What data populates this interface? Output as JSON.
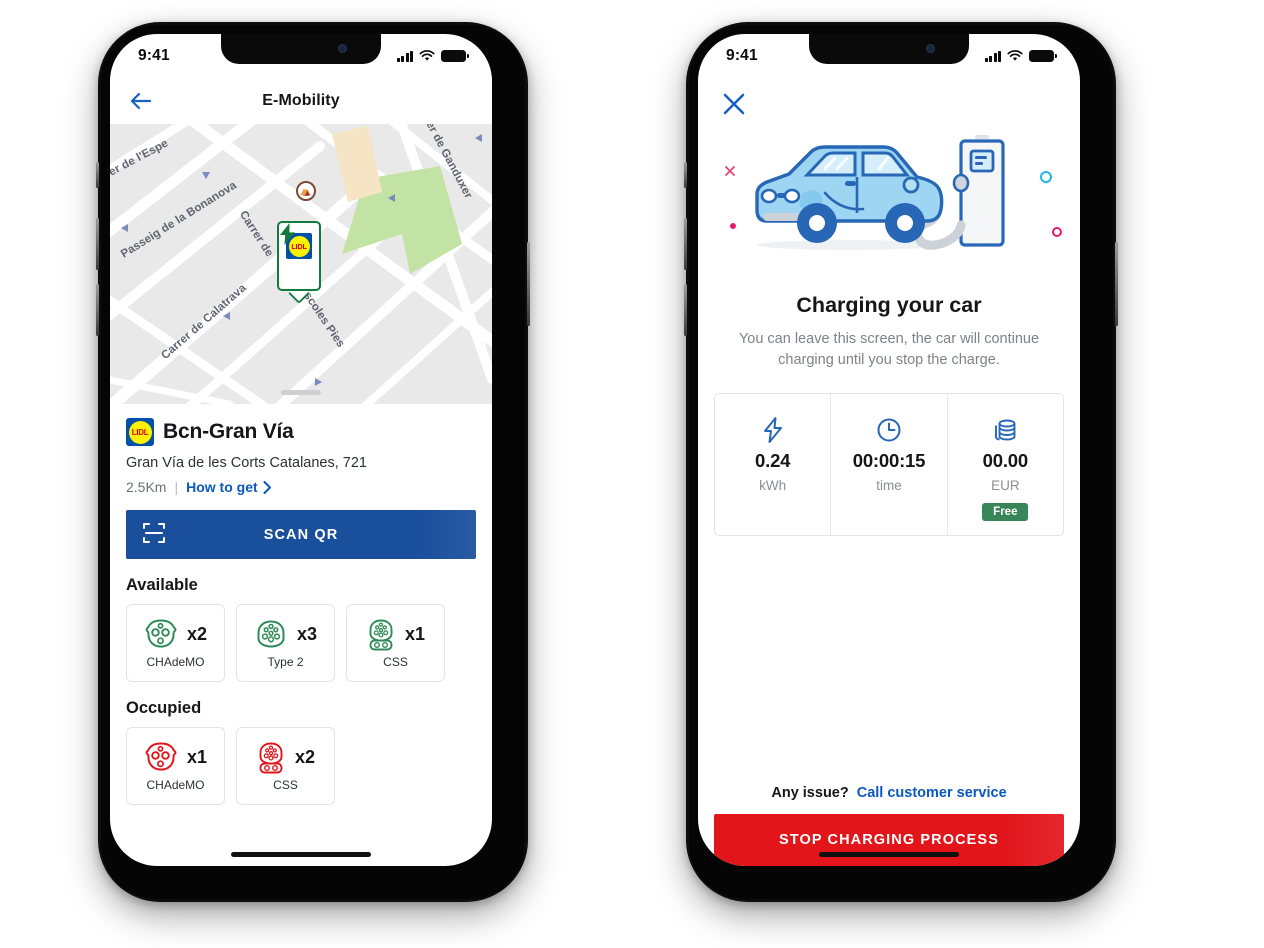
{
  "colors": {
    "brand_blue": "#1a4f9c",
    "link_blue": "#0a58c2",
    "danger_red": "#e2151b",
    "available_green": "#2e8b57",
    "occupied_red": "#e2151b",
    "free_badge_green": "#39855a",
    "lidl_blue": "#0050aa",
    "lidl_yellow": "#fff200",
    "lidl_red": "#e3000f",
    "map_bg": "#e9e9e9",
    "map_park_green": "#c3e3a5"
  },
  "left_phone": {
    "status_bar": {
      "time": "9:41",
      "signal_icon": "cellular-signal-icon",
      "wifi_icon": "wifi-icon",
      "battery_icon": "battery-icon"
    },
    "navbar": {
      "back_icon": "arrow-left-icon",
      "title": "E-Mobility"
    },
    "map": {
      "street_labels": [
        "er de l'Espe",
        "Passeig de la Bonanova",
        "Carrer de",
        "Carrer de Calatrava",
        "scoles Pies",
        "er de Ganduxer"
      ],
      "pin": {
        "charge_icon": "lightning-bolt-icon",
        "brand_icon": "lidl-logo-icon",
        "brand_text": "LIDL"
      },
      "poi_icon": "landmark-icon",
      "drag_handle": "sheet-drag-handle"
    },
    "station": {
      "brand_logo_text": "LIDL",
      "name": "Bcn-Gran Vía",
      "address": "Gran Vía de les Corts Catalanes, 721",
      "distance": "2.5Km",
      "separator": "|",
      "how_to_get": "How to get",
      "chevron_icon": "chevron-right-icon"
    },
    "scan_button": {
      "label": "SCAN QR",
      "icon": "qr-scan-icon"
    },
    "connectors": {
      "available_title": "Available",
      "available": [
        {
          "icon": "chademo-connector-icon",
          "count": "x2",
          "label": "CHAdeMO"
        },
        {
          "icon": "type2-connector-icon",
          "count": "x3",
          "label": "Type 2"
        },
        {
          "icon": "ccs-connector-icon",
          "count": "x1",
          "label": "CSS"
        }
      ],
      "occupied_title": "Occupied",
      "occupied": [
        {
          "icon": "chademo-connector-icon",
          "count": "x1",
          "label": "CHAdeMO"
        },
        {
          "icon": "ccs-connector-icon",
          "count": "x2",
          "label": "CSS"
        }
      ]
    }
  },
  "right_phone": {
    "status_bar": {
      "time": "9:41",
      "signal_icon": "cellular-signal-icon",
      "wifi_icon": "wifi-icon",
      "battery_icon": "battery-icon"
    },
    "close_icon": "close-x-icon",
    "illustration": "electric-car-charging-illustration",
    "decorations": [
      "cross-mark-pink",
      "dot-pink",
      "ring-cyan",
      "ring-pink"
    ],
    "title": "Charging your car",
    "subtitle": "You can leave this screen, the car will continue charging until you stop the charge.",
    "stats": [
      {
        "icon": "lightning-bolt-icon",
        "value": "0.24",
        "unit": "kWh",
        "badge": null
      },
      {
        "icon": "clock-icon",
        "value": "00:00:15",
        "unit": "time",
        "badge": null
      },
      {
        "icon": "coins-icon",
        "value": "00.00",
        "unit": "EUR",
        "badge": "Free"
      }
    ],
    "footer": {
      "issue_question": "Any issue?",
      "issue_link": "Call customer service",
      "stop_button": "STOP CHARGING PROCESS"
    }
  }
}
